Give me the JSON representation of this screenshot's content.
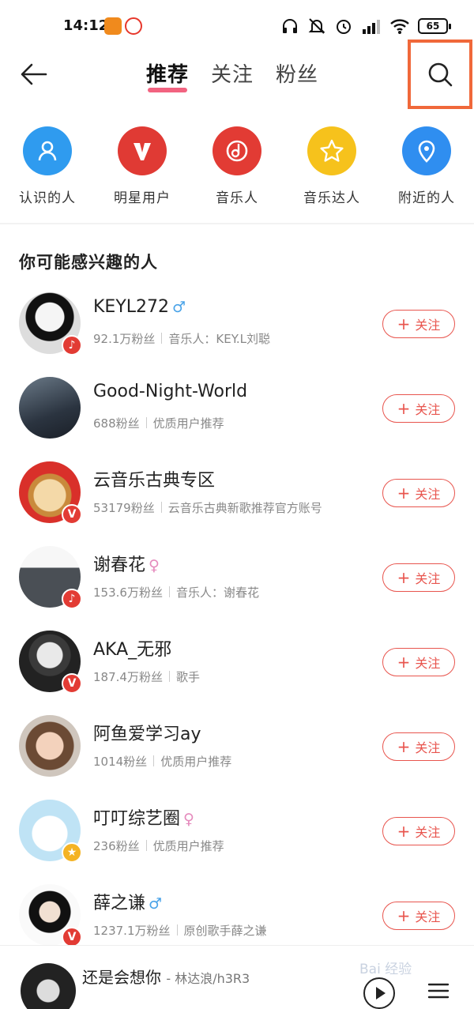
{
  "status_bar": {
    "time": "14:12",
    "battery": "65"
  },
  "nav": {
    "tabs": [
      {
        "label": "推荐",
        "active": true
      },
      {
        "label": "关注",
        "active": false
      },
      {
        "label": "粉丝",
        "active": false
      }
    ]
  },
  "categories": [
    {
      "label": "认识的人",
      "icon": "person-icon",
      "color": "#2f9bef"
    },
    {
      "label": "明星用户",
      "icon": "v-icon",
      "color": "#e03a34"
    },
    {
      "label": "音乐人",
      "icon": "music-note-icon",
      "color": "#e23b34"
    },
    {
      "label": "音乐达人",
      "icon": "star-icon",
      "color": "#f6c21c"
    },
    {
      "label": "附近的人",
      "icon": "location-pin-icon",
      "color": "#2f8ef0"
    }
  ],
  "section_title": "你可能感兴趣的人",
  "follow_label": "关注",
  "users": [
    {
      "name": "KEYL272",
      "gender": "♂",
      "fans": "92.1万粉丝",
      "desc": "音乐人：KEY.L刘聪",
      "badge": "music"
    },
    {
      "name": "Good-Night-World",
      "gender": "",
      "fans": "688粉丝",
      "desc": "优质用户推荐",
      "badge": ""
    },
    {
      "name": "云音乐古典专区",
      "gender": "",
      "fans": "53179粉丝",
      "desc": "云音乐古典新歌推荐官方账号",
      "badge": "v"
    },
    {
      "name": "谢春花",
      "gender": "♀",
      "fans": "153.6万粉丝",
      "desc": "音乐人：谢春花",
      "badge": "music"
    },
    {
      "name": "AKA_无邪",
      "gender": "",
      "fans": "187.4万粉丝",
      "desc": "歌手",
      "badge": "v"
    },
    {
      "name": "阿鱼爱学习ay",
      "gender": "",
      "fans": "1014粉丝",
      "desc": "优质用户推荐",
      "badge": ""
    },
    {
      "name": "叮叮综艺圈",
      "gender": "♀",
      "fans": "236粉丝",
      "desc": "优质用户推荐",
      "badge": "star"
    },
    {
      "name": "薛之谦",
      "gender": "♂",
      "fans": "1237.1万粉丝",
      "desc": "原创歌手薛之谦",
      "badge": "v"
    }
  ],
  "player": {
    "song": "还是会想你",
    "artist": "林达浪/h3R3"
  },
  "watermark": "Bai 经验"
}
